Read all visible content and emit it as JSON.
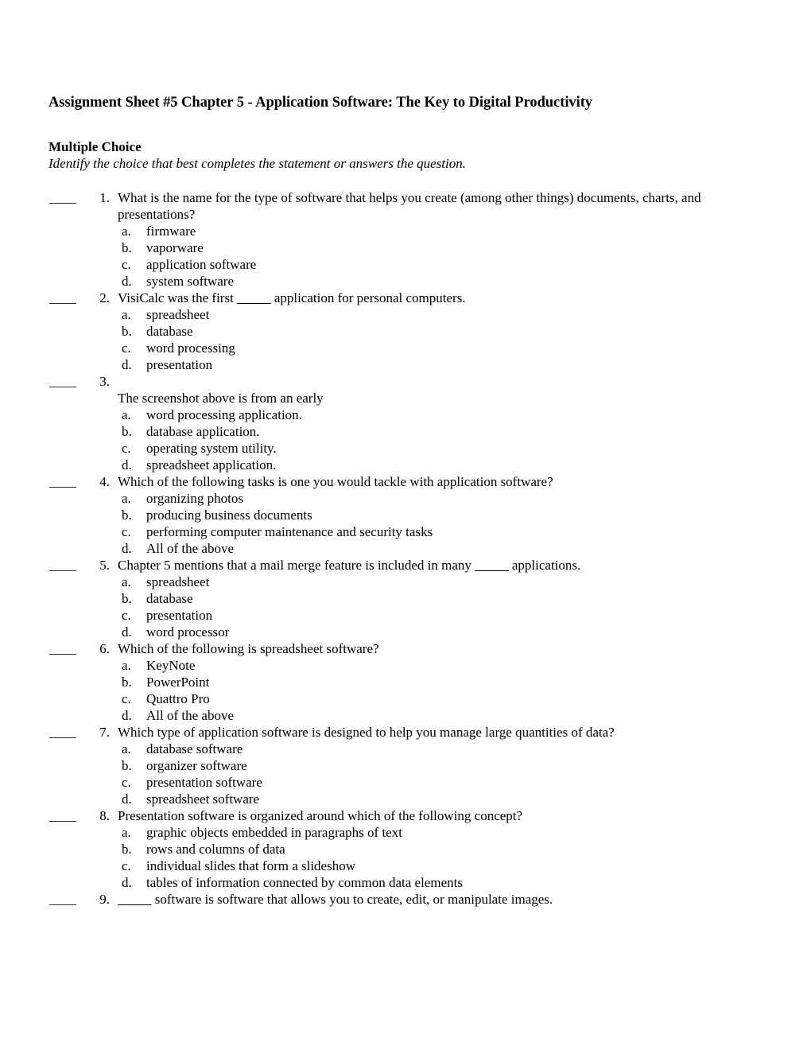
{
  "document": {
    "title": "Assignment Sheet #5 Chapter 5 - Application Software: The Key to Digital Productivity",
    "section_heading": "Multiple Choice",
    "section_instruction": "Identify the choice that best completes the statement or answers the question.",
    "answer_blank": "____"
  },
  "questions": [
    {
      "number": "1.",
      "stem": "What is the name for the type of software that helps you create (among other things) documents, charts, and presentations?",
      "stem_follow": "",
      "options": [
        {
          "letter": "a.",
          "text": "firmware"
        },
        {
          "letter": "b.",
          "text": "vaporware"
        },
        {
          "letter": "c.",
          "text": "application software"
        },
        {
          "letter": "d.",
          "text": "system software"
        }
      ]
    },
    {
      "number": "2.",
      "stem_pre": "VisiCalc was the first ",
      "stem_blank": "_____",
      "stem_post": " application for personal computers.",
      "options": [
        {
          "letter": "a.",
          "text": "spreadsheet"
        },
        {
          "letter": "b.",
          "text": "database"
        },
        {
          "letter": "c.",
          "text": "word processing"
        },
        {
          "letter": "d.",
          "text": "presentation"
        }
      ]
    },
    {
      "number": "3.",
      "stem": "",
      "stem_follow": "The screenshot above is from an early",
      "options": [
        {
          "letter": "a.",
          "text": "word processing application."
        },
        {
          "letter": "b.",
          "text": "database application."
        },
        {
          "letter": "c.",
          "text": "operating system utility."
        },
        {
          "letter": "d.",
          "text": "spreadsheet application."
        }
      ]
    },
    {
      "number": "4.",
      "stem": "Which of the following tasks is one you would tackle with application software?",
      "stem_follow": "",
      "options": [
        {
          "letter": "a.",
          "text": "organizing photos"
        },
        {
          "letter": "b.",
          "text": "producing business documents"
        },
        {
          "letter": "c.",
          "text": "performing computer maintenance and security tasks"
        },
        {
          "letter": "d.",
          "text": "All of the above"
        }
      ]
    },
    {
      "number": "5.",
      "stem_pre": "Chapter 5 mentions that a mail merge feature is included in many ",
      "stem_blank": "_____",
      "stem_post": " applications.",
      "options": [
        {
          "letter": "a.",
          "text": "spreadsheet"
        },
        {
          "letter": "b.",
          "text": "database"
        },
        {
          "letter": "c.",
          "text": "presentation"
        },
        {
          "letter": "d.",
          "text": "word processor"
        }
      ]
    },
    {
      "number": "6.",
      "stem": "Which of the following is spreadsheet software?",
      "stem_follow": "",
      "options": [
        {
          "letter": "a.",
          "text": "KeyNote"
        },
        {
          "letter": "b.",
          "text": "PowerPoint"
        },
        {
          "letter": "c.",
          "text": "Quattro Pro"
        },
        {
          "letter": "d.",
          "text": "All of the above"
        }
      ]
    },
    {
      "number": "7.",
      "stem": "Which type of application software is designed to help you manage large quantities of data?",
      "stem_follow": "",
      "options": [
        {
          "letter": "a.",
          "text": "database software"
        },
        {
          "letter": "b.",
          "text": "organizer software"
        },
        {
          "letter": "c.",
          "text": "presentation software"
        },
        {
          "letter": "d.",
          "text": "spreadsheet software"
        }
      ]
    },
    {
      "number": "8.",
      "stem": "Presentation software is organized around which of the following concept?",
      "stem_follow": "",
      "options": [
        {
          "letter": "a.",
          "text": "graphic objects embedded in paragraphs of text"
        },
        {
          "letter": "b.",
          "text": "rows and columns of data"
        },
        {
          "letter": "c.",
          "text": "individual slides that form a slideshow"
        },
        {
          "letter": "d.",
          "text": "tables of information connected by common data elements"
        }
      ]
    },
    {
      "number": "9.",
      "stem_pre": "",
      "stem_blank": "_____",
      "stem_post": " software is software that allows you to create, edit, or manipulate images.",
      "options": []
    }
  ]
}
